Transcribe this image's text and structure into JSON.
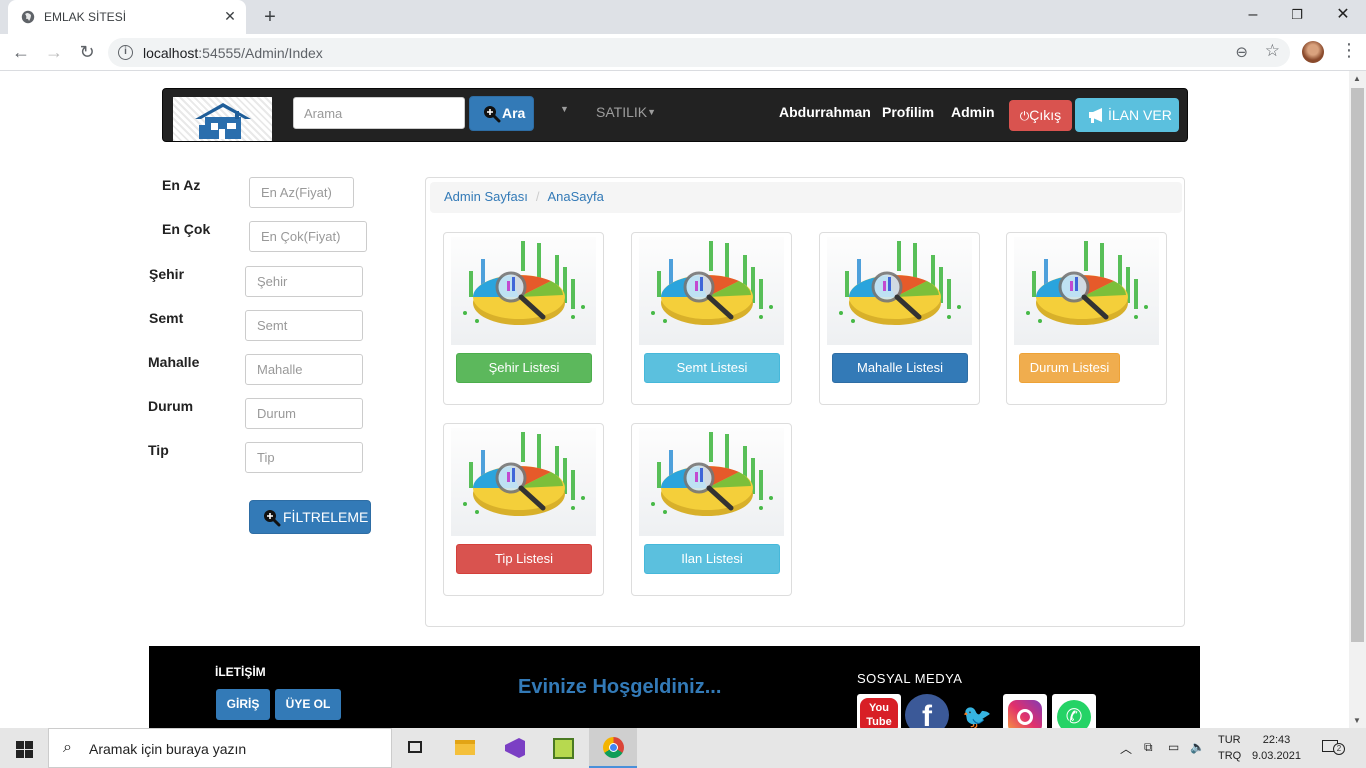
{
  "browser": {
    "tab_title": "EMLAK SİTESİ",
    "url_host": "localhost",
    "url_path": ":54555/Admin/Index"
  },
  "navbar": {
    "search_placeholder": "Arama",
    "search_button": "Ara",
    "satilik": "SATILIK",
    "links": [
      "Abdurrahman",
      "Profilim",
      "Admin"
    ],
    "logout_label": "Çıkış",
    "ilan_ver_label": "İLAN VER"
  },
  "filters": {
    "items": [
      {
        "label": "En Az",
        "placeholder": "En Az(Fiyat)"
      },
      {
        "label": "En Çok",
        "placeholder": "En Çok(Fiyat)"
      },
      {
        "label": "Şehir",
        "placeholder": "Şehir"
      },
      {
        "label": "Semt",
        "placeholder": "Semt"
      },
      {
        "label": "Mahalle",
        "placeholder": "Mahalle"
      },
      {
        "label": "Durum",
        "placeholder": "Durum"
      },
      {
        "label": "Tip",
        "placeholder": "Tip"
      }
    ],
    "button": "FİLTRELEME"
  },
  "admin": {
    "breadcrumb": [
      "Admin Sayfası",
      "AnaSayfa"
    ],
    "cards": [
      {
        "label": "Şehir Listesi",
        "style": "success"
      },
      {
        "label": "Semt Listesi",
        "style": "info"
      },
      {
        "label": "Mahalle Listesi",
        "style": "primary"
      },
      {
        "label": "Durum Listesi",
        "style": "warning"
      },
      {
        "label": "Tip Listesi",
        "style": "danger"
      },
      {
        "label": "Ilan Listesi",
        "style": "info"
      }
    ]
  },
  "footer": {
    "contact_title": "İLETİŞİM",
    "login_button": "GİRİŞ",
    "register_button": "ÜYE OL",
    "welcome": "Evinize Hoşgeldiniz...",
    "social_title": "SOSYAL MEDYA",
    "social_icons": [
      "youtube-icon",
      "facebook-icon",
      "twitter-icon",
      "instagram-icon",
      "whatsapp-icon"
    ],
    "youtube_text": "You Tube"
  },
  "taskbar": {
    "search_placeholder": "Aramak için buraya yazın",
    "lang_top": "TUR",
    "lang_bottom": "TRQ",
    "time": "22:43",
    "date": "9.03.2021",
    "notification_count": "2"
  }
}
